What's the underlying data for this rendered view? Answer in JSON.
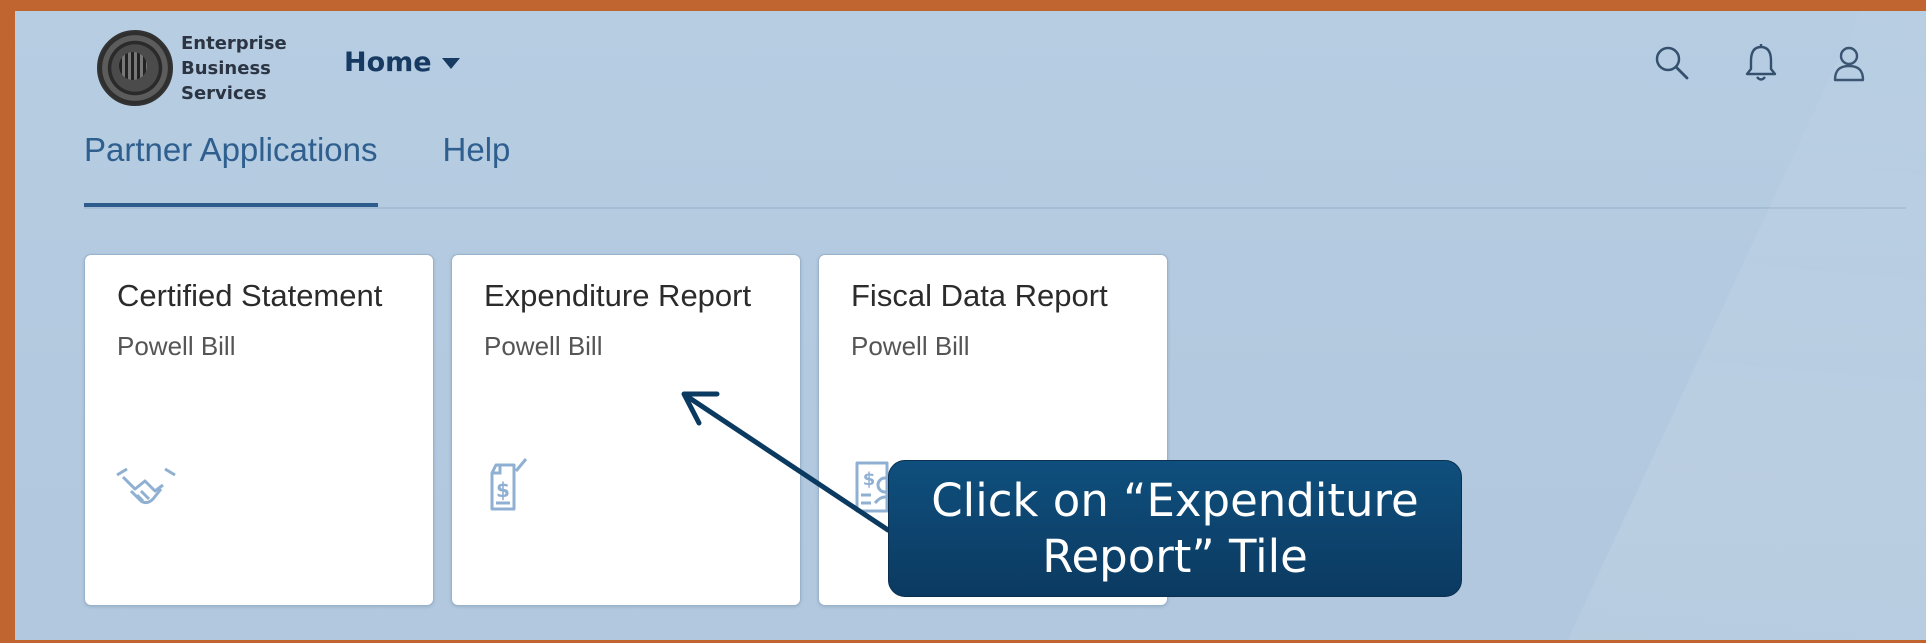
{
  "header": {
    "org_name": [
      "Enterprise",
      "Business",
      "Services"
    ],
    "home_label": "Home",
    "icons": [
      "search-icon",
      "bell-icon",
      "user-icon"
    ]
  },
  "tabs": [
    {
      "label": "Partner Applications",
      "active": true
    },
    {
      "label": "Help",
      "active": false
    }
  ],
  "tiles": [
    {
      "title": "Certified Statement",
      "subtitle": "Powell Bill",
      "icon": "handshake-icon"
    },
    {
      "title": "Expenditure Report",
      "subtitle": "Powell Bill",
      "icon": "expense-report-icon"
    },
    {
      "title": "Fiscal Data Report",
      "subtitle": "Powell Bill",
      "icon": "fiscal-report-icon"
    }
  ],
  "callout": {
    "line1": "Click on “Expenditure",
    "line2": "Report” Tile"
  },
  "colors": {
    "frame_border": "#c0652f",
    "background": "#b5cbe0",
    "accent": "#2e5c8d",
    "callout_bg": "#0d4470"
  }
}
